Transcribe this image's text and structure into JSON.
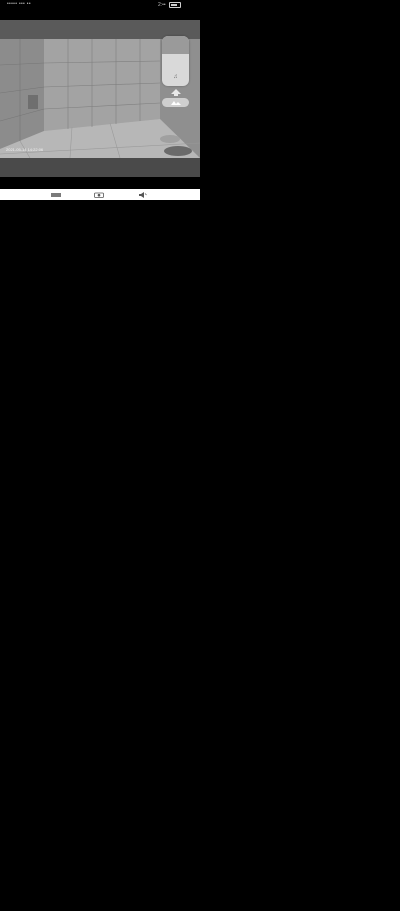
{
  "status_bar": {
    "left_text": "••••• ••• ••",
    "clock": "2:••"
  },
  "feed": {
    "caption": "2021-05-14 14:22:06",
    "icon": "camera-feed"
  },
  "side_panel": {
    "label": "♫",
    "up_icon": "arrow-up-icon",
    "flip_icon": "flip-icon"
  },
  "nav": {
    "left_icon": "menu-icon",
    "mid_icon": "camera-icon",
    "right_icon": "volume-icon"
  },
  "colors": {
    "background": "#000000",
    "player_frame": "#555555",
    "panel": "#d9d9d9",
    "nav_strip": "#ffffff"
  }
}
